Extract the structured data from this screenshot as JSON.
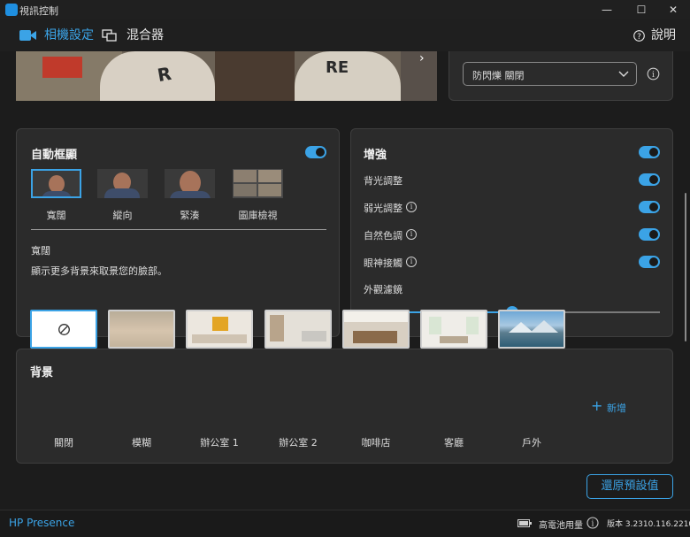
{
  "window": {
    "title": "視訊控制",
    "minimize": "—",
    "maximize": "☐",
    "close": "✕"
  },
  "nav": {
    "tab_camera": "相機設定",
    "tab_mixer": "混合器",
    "help": "說明"
  },
  "flicker": {
    "selected": "防閃爍 關閉"
  },
  "auto_frame": {
    "title": "自動框顯",
    "enabled": true,
    "options": [
      {
        "label": "寬闊",
        "selected": true
      },
      {
        "label": "縱向"
      },
      {
        "label": "緊湊"
      },
      {
        "label": "圖庫檢視"
      }
    ],
    "selected_name": "寬闊",
    "description": "顯示更多背景來取景您的臉部。"
  },
  "enhance": {
    "title": "增強",
    "enabled": true,
    "items": [
      {
        "label": "背光調整",
        "enabled": true
      },
      {
        "label": "弱光調整",
        "enabled": true
      },
      {
        "label": "自然色調",
        "enabled": true
      },
      {
        "label": "眼神接觸",
        "enabled": true
      }
    ],
    "filter_label": "外觀濾鏡",
    "filter_value": 0.5
  },
  "background": {
    "title": "背景",
    "items": [
      "關閉",
      "模糊",
      "辦公室 1",
      "辦公室 2",
      "咖啡店",
      "客廳",
      "戶外"
    ],
    "selected": "關閉",
    "add_label": "新增"
  },
  "reset_label": "還原預設值",
  "footer": {
    "brand": "HP Presence",
    "battery": "高電池用量",
    "version": "版本 3.2310.116.22101"
  },
  "colors": {
    "accent": "#3ba3e6",
    "card": "#2b2b2b",
    "background": "#1c1c1c"
  }
}
